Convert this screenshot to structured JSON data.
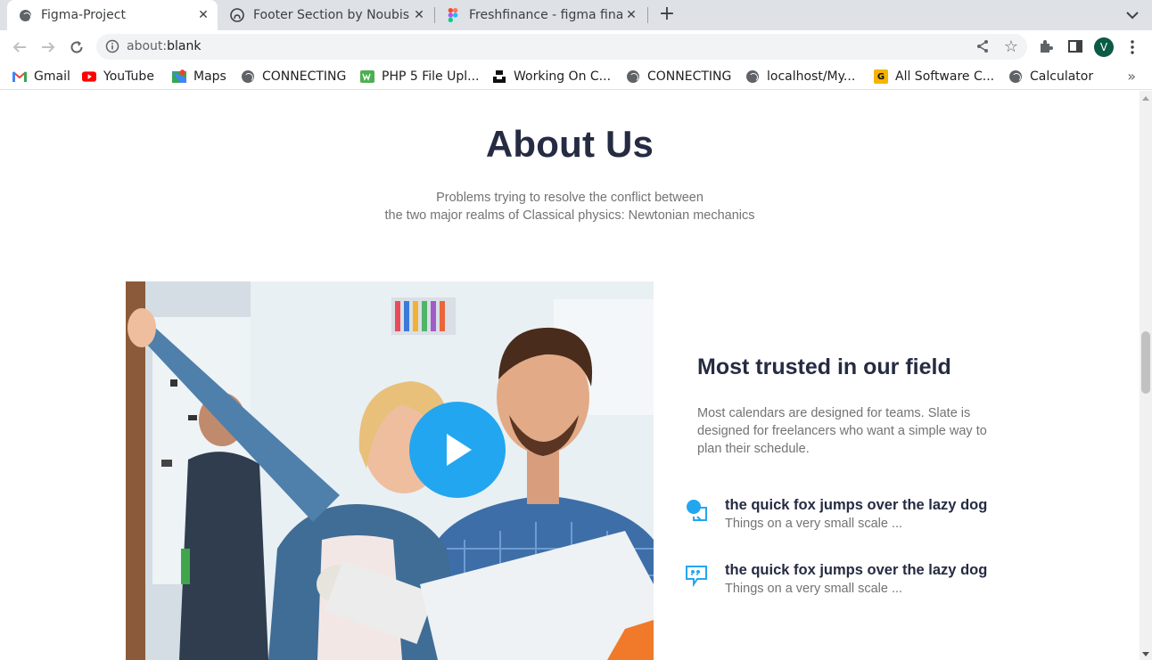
{
  "browser": {
    "tabs": [
      {
        "title": "Figma-Project",
        "active": true,
        "favicon": "globe-icon"
      },
      {
        "title": "Footer Section by Noubis",
        "active": false,
        "favicon": "github-icon"
      },
      {
        "title": "Freshfinance - figma finan",
        "active": false,
        "favicon": "figma-icon"
      }
    ],
    "close_glyph": "✕",
    "new_tab_glyph": "+",
    "address": {
      "prefix": "about:",
      "value": "blank"
    },
    "avatar_letter": "V",
    "bookmarks": [
      {
        "label": "Gmail",
        "icon": "gmail-icon"
      },
      {
        "label": "YouTube",
        "icon": "youtube-icon"
      },
      {
        "label": "Maps",
        "icon": "maps-icon"
      },
      {
        "label": "CONNECTING",
        "icon": "globe-icon"
      },
      {
        "label": "PHP 5 File Upl...",
        "icon": "w3schools-icon"
      },
      {
        "label": "Working On C...",
        "icon": "unsplash-icon"
      },
      {
        "label": "CONNECTING",
        "icon": "globe-icon"
      },
      {
        "label": "localhost/My...",
        "icon": "globe-icon"
      },
      {
        "label": "All Software C...",
        "icon": "g-icon"
      },
      {
        "label": "Calculator",
        "icon": "globe-icon"
      }
    ],
    "more_glyph": "»"
  },
  "page": {
    "title": "About Us",
    "subtitle_line1": "Problems trying to resolve the conflict between",
    "subtitle_line2": "the two major realms of Classical physics: Newtonian mechanics",
    "trust_title": "Most trusted in our field",
    "trust_text": "Most calendars are designed for teams. Slate is designed for freelancers who want a simple way to plan their schedule.",
    "features": [
      {
        "heading": "the quick fox jumps over the lazy dog",
        "text": "Things on a very small scale ...",
        "icon": "chat-bubble-icon"
      },
      {
        "heading": "the quick fox jumps over the lazy dog",
        "text": "Things on a very small scale ...",
        "icon": "quote-bubble-icon"
      }
    ]
  },
  "colors": {
    "accent": "#23a6f0",
    "heading": "#252b42",
    "muted": "#737373"
  }
}
